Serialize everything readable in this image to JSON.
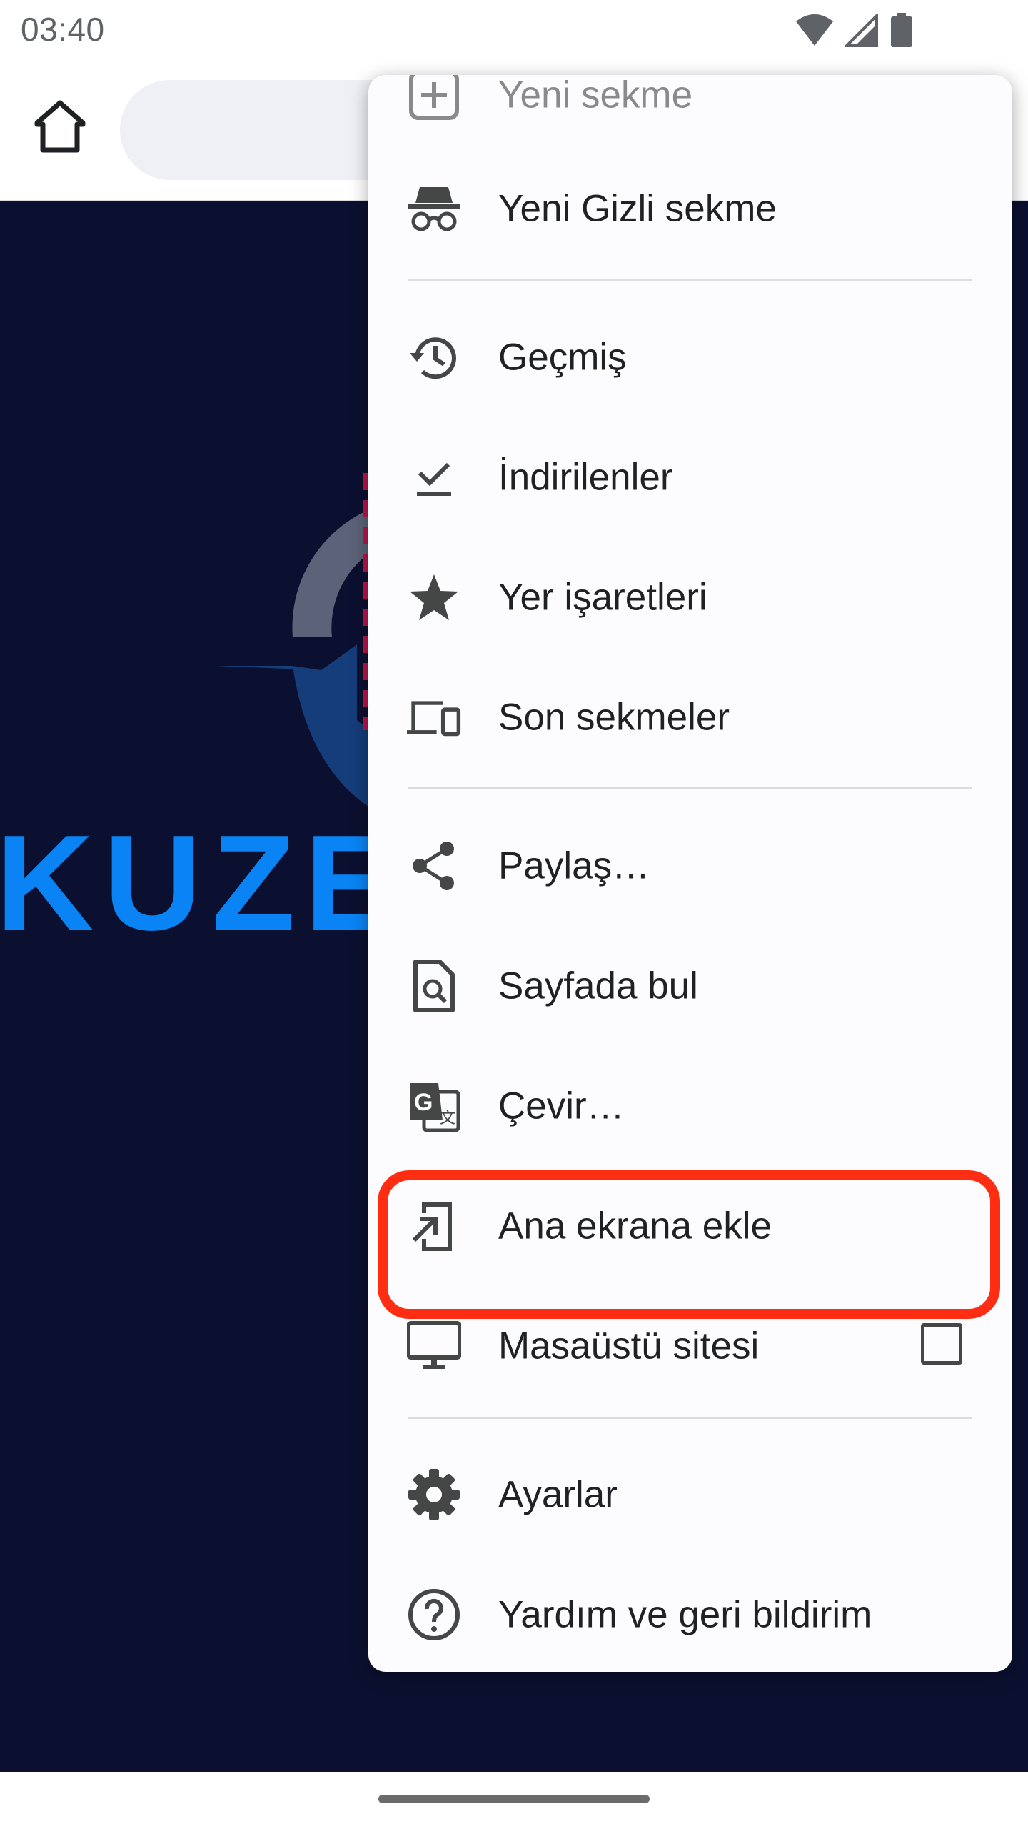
{
  "status_bar": {
    "time": "03:40",
    "icons": [
      "wifi-icon",
      "cell-signal-icon",
      "battery-icon"
    ]
  },
  "toolbar": {
    "home_icon": "home-icon",
    "omnibox_text": ""
  },
  "page": {
    "brand_partial": "KUZE"
  },
  "menu": {
    "items": [
      {
        "label": "Yeni sekme",
        "icon": "new-tab-icon"
      },
      {
        "label": "Yeni Gizli sekme",
        "icon": "incognito-icon"
      },
      {
        "label": "Geçmiş",
        "icon": "history-icon"
      },
      {
        "label": "İndirilenler",
        "icon": "downloads-icon"
      },
      {
        "label": "Yer işaretleri",
        "icon": "star-icon"
      },
      {
        "label": "Son sekmeler",
        "icon": "devices-icon"
      },
      {
        "label": "Paylaş…",
        "icon": "share-icon"
      },
      {
        "label": "Sayfada bul",
        "icon": "find-in-page-icon"
      },
      {
        "label": "Çevir…",
        "icon": "translate-icon"
      },
      {
        "label": "Ana ekrana ekle",
        "icon": "add-to-home-screen-icon"
      },
      {
        "label": "Masaüstü sitesi",
        "icon": "desktop-icon",
        "checkbox": false
      },
      {
        "label": "Ayarlar",
        "icon": "settings-icon"
      },
      {
        "label": "Yardım ve geri bildirim",
        "icon": "help-icon"
      }
    ],
    "highlighted_item": "Ana ekrana ekle"
  },
  "colors": {
    "highlight": "#ff2d12",
    "page_background": "#0b1030",
    "brand_blue": "#0a84f5",
    "menu_background": "#fcfbfe"
  }
}
